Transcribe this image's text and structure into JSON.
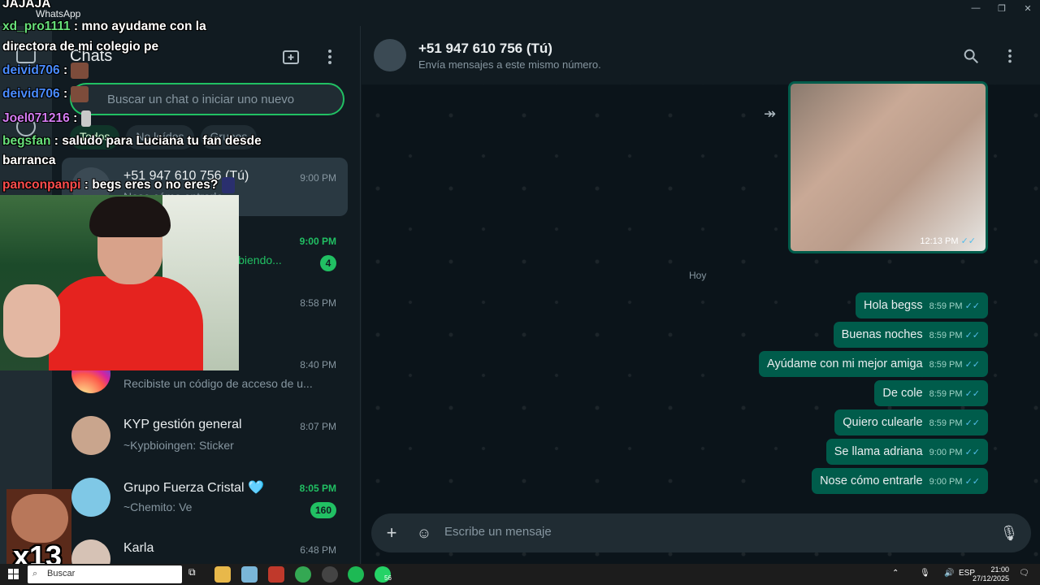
{
  "window": {
    "app_title": "WhatsApp"
  },
  "sidebar": {
    "title": "Chats",
    "search_placeholder": "Buscar un chat o iniciar uno nuevo",
    "filters": [
      "Todos",
      "No leídos",
      "Grupos"
    ],
    "chats": [
      {
        "name": "+51 947 610 756 (Tú)",
        "time": "9:00 PM",
        "preview": "Nose cómo entrarle",
        "time_green": false
      },
      {
        "name": "",
        "time": "9:00 PM",
        "preview": "ibiendo...",
        "time_green": true,
        "badge": "4"
      },
      {
        "name": "",
        "time": "8:58 PM",
        "preview": "",
        "time_green": false
      },
      {
        "name": "",
        "time": "8:40 PM",
        "preview": "Recibiste un código de acceso de u...",
        "time_green": false
      },
      {
        "name": "KYP gestión general",
        "time": "8:07 PM",
        "preview": "~Kypbioingen: Sticker",
        "time_green": false
      },
      {
        "name": "Grupo Fuerza Cristal 🩵",
        "time": "8:05 PM",
        "preview": "~Chemito: Ve",
        "time_green": true,
        "badge": "160"
      },
      {
        "name": "Karla",
        "time": "6:48 PM",
        "preview": "",
        "time_green": false
      }
    ]
  },
  "conversation": {
    "contact_name": "+51 947 610 756 (Tú)",
    "contact_sub": "Envía mensajes a este mismo número.",
    "media_time": "12:13 PM",
    "date_chip": "Hoy",
    "messages": [
      {
        "text": "Hola begss",
        "time": "8:59 PM"
      },
      {
        "text": "Buenas noches",
        "time": "8:59 PM"
      },
      {
        "text": "Ayúdame con mi mejor amiga",
        "time": "8:59 PM"
      },
      {
        "text": "De cole",
        "time": "8:59 PM"
      },
      {
        "text": "Quiero culearle",
        "time": "8:59 PM"
      },
      {
        "text": "Se llama adriana",
        "time": "9:00 PM"
      },
      {
        "text": "Nose cómo entrarle",
        "time": "9:00 PM"
      }
    ],
    "composer_placeholder": "Escribe un mensaje"
  },
  "stream_chat": [
    {
      "user": "",
      "text": "JAJAJA"
    },
    {
      "user": "xd_pro1111",
      "text": ": mno ayudame con la"
    },
    {
      "user": "",
      "text": "directora de mi colegio pe"
    },
    {
      "user": "deivid706",
      "text": ":"
    },
    {
      "user": "deivid706",
      "text": ":"
    },
    {
      "user": "Joel071216",
      "text": ":"
    },
    {
      "user": "begsfan",
      "text": ": saludo para Luciana tu fan desde"
    },
    {
      "user": "",
      "text": "barranca"
    },
    {
      "user": "panconpanpi",
      "text": ": begs eres o no eres?"
    }
  ],
  "sticker_overlay": {
    "text": "x13"
  },
  "taskbar": {
    "search_label": "Buscar",
    "whatsapp_badge": "56",
    "language": "ESP",
    "time": "21:00",
    "date": "27/12/2025"
  },
  "colors": {
    "accent": "#21c063",
    "bubble_out": "#005c4b",
    "panel": "#111b21",
    "chat_bg": "#0b141a"
  }
}
